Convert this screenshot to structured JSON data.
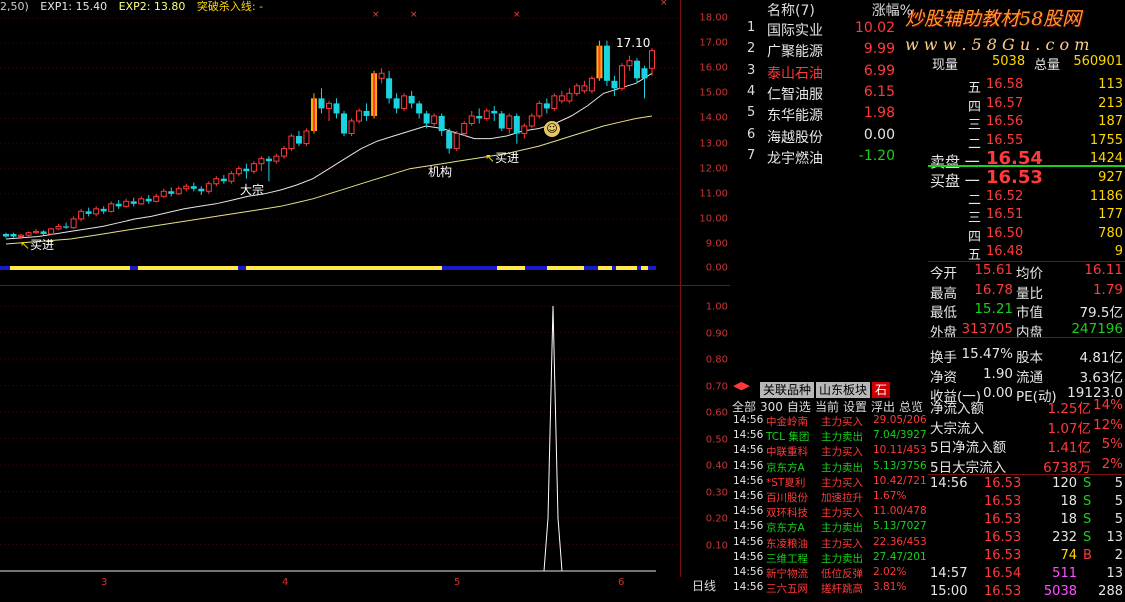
{
  "header": {
    "params": "2,50)",
    "exp1": "EXP1: 15.40",
    "exp2": "EXP2: 13.80",
    "indicator": "突破杀入线: -"
  },
  "annotations": {
    "buy1": "买进",
    "buy2": "买进",
    "dazong": "大宗",
    "jigou": "机构",
    "peak": "17.10"
  },
  "price_axis": [
    "18.00",
    "17.00",
    "16.00",
    "15.00",
    "14.00",
    "13.00",
    "12.00",
    "11.00",
    "10.00",
    "9.00",
    "0.00"
  ],
  "sub_axis": [
    "1.00",
    "0.90",
    "0.80",
    "0.70",
    "0.60",
    "0.50",
    "0.40",
    "0.30",
    "0.20",
    "0.10"
  ],
  "x_months": [
    "3",
    "4",
    "5",
    "6"
  ],
  "period": "日线",
  "watermark": {
    "line1": "炒股辅助教材58股网",
    "line2": "w w w . 5 8 G u . c o m"
  },
  "rank": {
    "header_name": "名称(7)",
    "header_pct": "涨幅%",
    "items": [
      {
        "n": "1",
        "name": "国际实业",
        "pct": "10.02",
        "color": "#ff3a3a",
        "name_color": "#e6e6e6"
      },
      {
        "n": "2",
        "name": "广聚能源",
        "pct": "9.99",
        "color": "#ff3a3a",
        "name_color": "#e6e6e6"
      },
      {
        "n": "3",
        "name": "泰山石油",
        "pct": "6.99",
        "color": "#ff3a3a",
        "name_color": "#ff3a3a"
      },
      {
        "n": "4",
        "name": "仁智油服",
        "pct": "6.15",
        "color": "#ff3a3a",
        "name_color": "#e6e6e6"
      },
      {
        "n": "5",
        "name": "东华能源",
        "pct": "1.98",
        "color": "#ff3a3a",
        "name_color": "#e6e6e6"
      },
      {
        "n": "6",
        "name": "海越股份",
        "pct": "0.00",
        "color": "#e6e6e6",
        "name_color": "#e6e6e6"
      },
      {
        "n": "7",
        "name": "龙宇燃油",
        "pct": "-1.20",
        "color": "#19d119",
        "name_color": "#e6e6e6"
      }
    ]
  },
  "quote": {
    "xianliang_label": "现量",
    "xianliang": "5038",
    "zongliang_label": "总量",
    "zongliang": "560901",
    "sell": [
      {
        "label": "五",
        "price": "16.58",
        "vol": "113"
      },
      {
        "label": "四",
        "price": "16.57",
        "vol": "213"
      },
      {
        "label": "三",
        "price": "16.56",
        "vol": "187"
      },
      {
        "label": "二",
        "price": "16.55",
        "vol": "1755"
      },
      {
        "label": "卖盘 一",
        "price": "16.54",
        "vol": "1424"
      }
    ],
    "buy": [
      {
        "label": "买盘 一",
        "price": "16.53",
        "vol": "927"
      },
      {
        "label": "二",
        "price": "16.52",
        "vol": "1186"
      },
      {
        "label": "三",
        "price": "16.51",
        "vol": "177"
      },
      {
        "label": "四",
        "price": "16.50",
        "vol": "780"
      },
      {
        "label": "五",
        "price": "16.48",
        "vol": "9"
      }
    ],
    "stats": [
      {
        "l1": "今开",
        "v1": "15.61",
        "c1": "#ff3a3a",
        "l2": "均价",
        "v2": "16.11",
        "c2": "#ff3a3a"
      },
      {
        "l1": "最高",
        "v1": "16.78",
        "c1": "#ff3a3a",
        "l2": "量比",
        "v2": "1.79",
        "c2": "#ff3a3a"
      },
      {
        "l1": "最低",
        "v1": "15.21",
        "c1": "#19d119",
        "l2": "市值",
        "v2": "79.5亿",
        "c2": "#e6e6e6"
      },
      {
        "l1": "外盘",
        "v1": "313705",
        "c1": "#ff3a3a",
        "l2": "内盘",
        "v2": "247196",
        "c2": "#19d119"
      },
      {
        "l1": "换手",
        "v1": "15.47%",
        "c1": "#e6e6e6",
        "l2": "股本",
        "v2": "4.81亿",
        "c2": "#e6e6e6"
      },
      {
        "l1": "净资",
        "v1": "1.90",
        "c1": "#e6e6e6",
        "l2": "流通",
        "v2": "3.63亿",
        "c2": "#e6e6e6"
      },
      {
        "l1": "收益(一)",
        "v1": "0.00",
        "c1": "#e6e6e6",
        "l2": "PE(动)",
        "v2": "19123.0",
        "c2": "#e6e6e6"
      }
    ],
    "flows": [
      {
        "label": "净流入额",
        "val": "1.25亿",
        "pct": "14%"
      },
      {
        "label": "大宗流入",
        "val": "1.07亿",
        "pct": "12%"
      },
      {
        "label": "5日净流入额",
        "val": "1.41亿",
        "pct": "5%"
      },
      {
        "label": "5日大宗流入",
        "val": "6738万",
        "pct": "2%"
      }
    ],
    "ticks": [
      {
        "t": "14:56",
        "p": "16.53",
        "v": "120",
        "s": "S",
        "n": "5"
      },
      {
        "t": "",
        "p": "16.53",
        "v": "18",
        "s": "S",
        "n": "5"
      },
      {
        "t": "",
        "p": "16.53",
        "v": "18",
        "s": "S",
        "n": "5"
      },
      {
        "t": "",
        "p": "16.53",
        "v": "232",
        "s": "S",
        "n": "13"
      },
      {
        "t": "",
        "p": "16.53",
        "v": "74",
        "s": "B",
        "n": "2"
      },
      {
        "t": "14:57",
        "p": "16.54",
        "v": "511",
        "s": "",
        "n": "13"
      },
      {
        "t": "15:00",
        "p": "16.53",
        "v": "5038",
        "s": "",
        "n": "288"
      }
    ]
  },
  "feed": {
    "tabs": [
      "关联品种",
      "山东板块",
      "石"
    ],
    "menu": [
      "全部",
      "300",
      "自选",
      "当前",
      "设置",
      "浮出",
      "总览"
    ],
    "rows": [
      {
        "t": "14:56",
        "name": "中金岭南",
        "act": "主力买入",
        "val": "29.05/206",
        "c": "#ff3a3a"
      },
      {
        "t": "14:56",
        "name": "TCL 集团",
        "act": "主力卖出",
        "val": "7.04/3927",
        "c": "#19d119"
      },
      {
        "t": "14:56",
        "name": "中联重科",
        "act": "主力买入",
        "val": "10.11/453",
        "c": "#ff3a3a"
      },
      {
        "t": "14:56",
        "name": "京东方A",
        "act": "主力卖出",
        "val": "5.13/3756",
        "c": "#19d119"
      },
      {
        "t": "14:56",
        "name": "*ST夏利",
        "act": "主力买入",
        "val": "10.42/721",
        "c": "#ff3a3a"
      },
      {
        "t": "14:56",
        "name": "百川股份",
        "act": "加速拉升",
        "val": "1.67%",
        "c": "#ff3a3a"
      },
      {
        "t": "14:56",
        "name": "双环科技",
        "act": "主力买入",
        "val": "11.00/478",
        "c": "#ff3a3a"
      },
      {
        "t": "14:56",
        "name": "京东方A",
        "act": "主力卖出",
        "val": "5.13/7027",
        "c": "#19d119"
      },
      {
        "t": "14:56",
        "name": "东凌粮油",
        "act": "主力买入",
        "val": "22.36/453",
        "c": "#ff3a3a"
      },
      {
        "t": "14:56",
        "name": "三维工程",
        "act": "主力卖出",
        "val": "27.47/201",
        "c": "#19d119"
      },
      {
        "t": "14:56",
        "name": "新宁物流",
        "act": "低位反弹",
        "val": "2.02%",
        "c": "#ff3a3a"
      },
      {
        "t": "14:56",
        "name": "三六五网",
        "act": "搓杆跳高",
        "val": "3.81%",
        "c": "#ff3a3a"
      }
    ]
  },
  "chart_data": {
    "type": "candlestick",
    "ylim": [
      9,
      18.4
    ],
    "ma_fast": [
      9.2,
      9.25,
      9.3,
      9.4,
      9.5,
      9.6,
      9.7,
      9.85,
      10.0,
      10.1,
      10.25,
      10.4,
      10.5,
      10.6,
      10.75,
      10.9,
      11.0,
      11.15,
      11.35,
      11.6,
      12.0,
      12.4,
      12.8,
      13.1,
      13.3,
      13.5,
      13.7,
      13.6,
      13.4,
      13.2,
      13.2,
      13.3,
      13.5,
      13.6,
      13.8,
      14.1,
      14.5,
      15.0,
      15.2,
      15.4,
      15.8
    ],
    "ma_slow": [
      9.0,
      9.05,
      9.1,
      9.15,
      9.2,
      9.3,
      9.4,
      9.5,
      9.6,
      9.7,
      9.8,
      9.9,
      10.0,
      10.1,
      10.2,
      10.3,
      10.4,
      10.5,
      10.65,
      10.8,
      11.0,
      11.2,
      11.4,
      11.6,
      11.8,
      12.0,
      12.1,
      12.2,
      12.3,
      12.4,
      12.5,
      12.6,
      12.75,
      12.9,
      13.1,
      13.3,
      13.5,
      13.7,
      13.85,
      14.0,
      14.1
    ],
    "candles": [
      [
        9.3,
        9.4,
        9.45,
        9.25,
        "c"
      ],
      [
        9.4,
        9.3,
        9.45,
        9.25,
        "c"
      ],
      [
        9.3,
        9.35,
        9.4,
        9.2,
        "r"
      ],
      [
        9.35,
        9.45,
        9.5,
        9.3,
        "r"
      ],
      [
        9.45,
        9.5,
        9.6,
        9.4,
        "r"
      ],
      [
        9.5,
        9.4,
        9.55,
        9.35,
        "c"
      ],
      [
        9.4,
        9.6,
        9.65,
        9.35,
        "r"
      ],
      [
        9.6,
        9.7,
        9.8,
        9.55,
        "r"
      ],
      [
        9.7,
        9.65,
        9.85,
        9.6,
        "c"
      ],
      [
        9.65,
        10.0,
        10.1,
        9.6,
        "r"
      ],
      [
        10.0,
        10.3,
        10.4,
        9.9,
        "r"
      ],
      [
        10.3,
        10.2,
        10.45,
        10.1,
        "c"
      ],
      [
        10.2,
        10.4,
        10.5,
        10.1,
        "r"
      ],
      [
        10.4,
        10.3,
        10.5,
        10.2,
        "c"
      ],
      [
        10.3,
        10.6,
        10.7,
        10.25,
        "r"
      ],
      [
        10.6,
        10.5,
        10.75,
        10.4,
        "c"
      ],
      [
        10.5,
        10.7,
        10.8,
        10.45,
        "r"
      ],
      [
        10.7,
        10.6,
        10.85,
        10.5,
        "c"
      ],
      [
        10.6,
        10.8,
        10.9,
        10.55,
        "r"
      ],
      [
        10.8,
        10.7,
        10.95,
        10.6,
        "c"
      ],
      [
        10.7,
        10.9,
        11.0,
        10.65,
        "r"
      ],
      [
        10.9,
        11.1,
        11.2,
        10.85,
        "r"
      ],
      [
        11.1,
        11.0,
        11.25,
        10.9,
        "c"
      ],
      [
        11.0,
        11.2,
        11.3,
        10.95,
        "r"
      ],
      [
        11.2,
        11.3,
        11.4,
        11.1,
        "r"
      ],
      [
        11.3,
        11.2,
        11.45,
        11.1,
        "c"
      ],
      [
        11.2,
        11.1,
        11.3,
        10.95,
        "c"
      ],
      [
        11.1,
        11.4,
        11.5,
        11.0,
        "r"
      ],
      [
        11.4,
        11.6,
        11.7,
        11.3,
        "r"
      ],
      [
        11.6,
        11.5,
        11.75,
        11.4,
        "c"
      ],
      [
        11.5,
        11.8,
        11.9,
        11.4,
        "r"
      ],
      [
        11.8,
        12.0,
        12.1,
        11.7,
        "r"
      ],
      [
        12.0,
        11.9,
        12.2,
        11.6,
        "c"
      ],
      [
        11.9,
        12.2,
        12.3,
        11.8,
        "r"
      ],
      [
        12.2,
        12.4,
        12.5,
        11.9,
        "r"
      ],
      [
        12.4,
        12.3,
        12.5,
        11.5,
        "c"
      ],
      [
        12.3,
        12.5,
        12.6,
        12.2,
        "r"
      ],
      [
        12.5,
        12.8,
        12.9,
        12.4,
        "r"
      ],
      [
        12.8,
        13.3,
        13.4,
        12.7,
        "r"
      ],
      [
        13.3,
        13.0,
        13.5,
        12.9,
        "c"
      ],
      [
        13.0,
        13.5,
        13.6,
        12.9,
        "r"
      ],
      [
        13.5,
        14.8,
        15.0,
        13.4,
        "y"
      ],
      [
        14.8,
        14.4,
        15.2,
        14.2,
        "c"
      ],
      [
        14.4,
        14.6,
        14.7,
        13.9,
        "r"
      ],
      [
        14.6,
        14.2,
        14.8,
        14.0,
        "c"
      ],
      [
        14.2,
        13.4,
        14.3,
        13.3,
        "c"
      ],
      [
        13.4,
        13.9,
        14.0,
        13.3,
        "r"
      ],
      [
        13.9,
        14.3,
        14.4,
        13.8,
        "r"
      ],
      [
        14.3,
        14.1,
        14.6,
        13.9,
        "c"
      ],
      [
        14.1,
        15.8,
        15.9,
        14.0,
        "y"
      ],
      [
        15.8,
        15.6,
        16.0,
        15.4,
        "r"
      ],
      [
        15.6,
        14.8,
        15.9,
        14.6,
        "c"
      ],
      [
        14.8,
        14.4,
        15.0,
        14.2,
        "c"
      ],
      [
        14.4,
        14.9,
        15.0,
        14.3,
        "r"
      ],
      [
        14.9,
        14.6,
        15.1,
        14.4,
        "c"
      ],
      [
        14.6,
        14.2,
        14.7,
        14.0,
        "c"
      ],
      [
        14.2,
        13.8,
        14.3,
        13.6,
        "c"
      ],
      [
        13.8,
        14.1,
        14.2,
        13.7,
        "r"
      ],
      [
        14.1,
        13.5,
        14.2,
        13.3,
        "c"
      ],
      [
        13.5,
        12.8,
        13.6,
        12.6,
        "c"
      ],
      [
        12.8,
        13.4,
        13.5,
        12.7,
        "r"
      ],
      [
        13.4,
        13.8,
        13.9,
        13.3,
        "r"
      ],
      [
        13.8,
        14.1,
        14.3,
        13.7,
        "r"
      ],
      [
        14.1,
        14.0,
        14.4,
        13.8,
        "c"
      ],
      [
        14.0,
        14.3,
        14.4,
        13.9,
        "r"
      ],
      [
        14.3,
        14.2,
        14.5,
        13.9,
        "c"
      ],
      [
        14.2,
        13.6,
        14.3,
        13.5,
        "c"
      ],
      [
        13.6,
        14.1,
        14.2,
        13.4,
        "r"
      ],
      [
        14.1,
        13.4,
        14.2,
        13.0,
        "c"
      ],
      [
        13.4,
        13.7,
        13.8,
        13.2,
        "r"
      ],
      [
        13.7,
        14.1,
        14.2,
        13.6,
        "r"
      ],
      [
        14.1,
        14.6,
        14.7,
        14.0,
        "r"
      ],
      [
        14.6,
        14.4,
        14.8,
        14.2,
        "c"
      ],
      [
        14.4,
        14.9,
        15.0,
        14.3,
        "r"
      ],
      [
        14.9,
        14.7,
        15.1,
        14.6,
        "r"
      ],
      [
        14.7,
        15.0,
        15.2,
        14.6,
        "r"
      ],
      [
        15.0,
        15.3,
        15.4,
        14.9,
        "r"
      ],
      [
        15.3,
        15.1,
        15.5,
        15.0,
        "r"
      ],
      [
        15.1,
        15.6,
        15.7,
        15.0,
        "r"
      ],
      [
        15.6,
        16.9,
        17.1,
        15.5,
        "y"
      ],
      [
        16.9,
        15.5,
        17.1,
        15.3,
        "c"
      ],
      [
        15.5,
        15.2,
        15.7,
        14.9,
        "c"
      ],
      [
        15.2,
        16.1,
        16.2,
        15.1,
        "r"
      ],
      [
        16.1,
        16.3,
        16.5,
        15.9,
        "r"
      ],
      [
        16.3,
        15.6,
        16.4,
        15.4,
        "c"
      ],
      [
        15.6,
        16.0,
        16.1,
        14.8,
        "c"
      ],
      [
        16.0,
        16.7,
        16.8,
        15.7,
        "r"
      ]
    ],
    "sub_spike": 1.0
  }
}
